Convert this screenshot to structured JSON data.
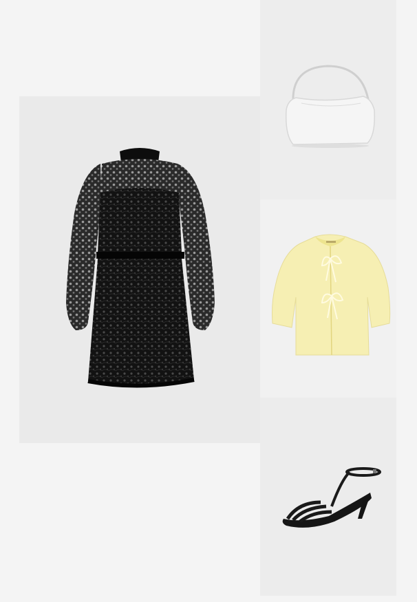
{
  "layout_name": "outfit-collage",
  "colors": {
    "page_background": "#f4f4f4",
    "dress_tile": "#eaeaea",
    "bag_tile": "#ededed",
    "cardigan_tile": "#f1f1f1",
    "sandal_tile": "#ececec",
    "dress": "#111111",
    "bag": "#f3f3f3",
    "cardigan": "#f5eeb2",
    "sandal": "#151515"
  },
  "products": [
    {
      "id": "dress",
      "icon": "black-lace-dress-image"
    },
    {
      "id": "bag",
      "icon": "white-shoulder-bag-image"
    },
    {
      "id": "cardigan",
      "icon": "yellow-tie-front-cardigan-image"
    },
    {
      "id": "sandal",
      "icon": "black-strappy-sandal-image"
    }
  ]
}
